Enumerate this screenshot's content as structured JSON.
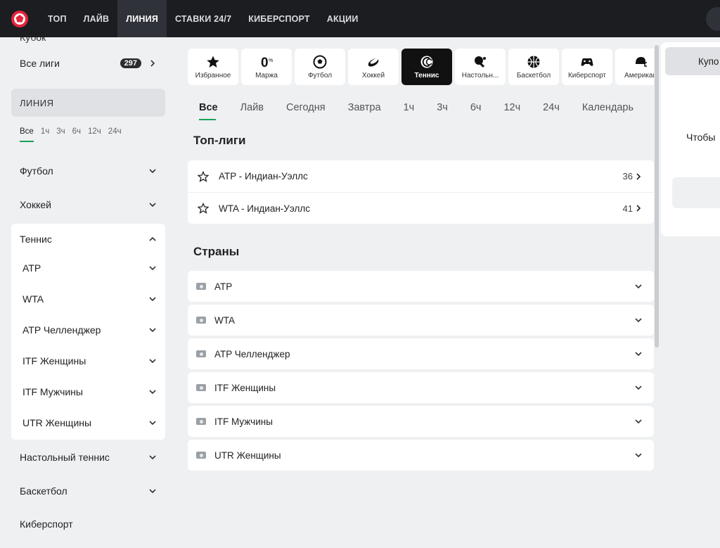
{
  "nav": {
    "items": [
      "ТОП",
      "ЛАЙВ",
      "ЛИНИЯ",
      "СТАВКИ 24/7",
      "КИБЕРСПОРТ",
      "АКЦИИ"
    ],
    "active_index": 2
  },
  "sidebar": {
    "cut_label": "Кубок",
    "all_leagues": "Все лиги",
    "all_leagues_count": "297",
    "section_title": "ЛИНИЯ",
    "time_filters": [
      "Все",
      "1ч",
      "3ч",
      "6ч",
      "12ч",
      "24ч"
    ],
    "sports_top": [
      "Футбол",
      "Хоккей"
    ],
    "expanded_sport": "Теннис",
    "tennis_sub": [
      "ATP",
      "WTA",
      "ATP Челленджер",
      "ITF Женщины",
      "ITF Мужчины",
      "UTR Женщины"
    ],
    "sports_bottom": [
      "Настольный теннис",
      "Баскетбол",
      "Киберспорт"
    ]
  },
  "sports_bar": {
    "items": [
      {
        "label": "Избранное",
        "icon": "star-icon"
      },
      {
        "label": "Маржа",
        "icon": "margin-zero-icon"
      },
      {
        "label": "Футбол",
        "icon": "soccer-ball-icon"
      },
      {
        "label": "Хоккей",
        "icon": "hockey-puck-icon"
      },
      {
        "label": "Теннис",
        "icon": "tennis-ball-icon"
      },
      {
        "label": "Настольн...",
        "icon": "table-tennis-icon"
      },
      {
        "label": "Баскетбол",
        "icon": "basketball-icon"
      },
      {
        "label": "Киберспорт",
        "icon": "gamepad-icon"
      },
      {
        "label": "Американ",
        "icon": "american-football-helmet-icon"
      }
    ],
    "active_index": 4
  },
  "tabs": {
    "items": [
      "Все",
      "Лайв",
      "Сегодня",
      "Завтра",
      "1ч",
      "3ч",
      "6ч",
      "12ч",
      "24ч",
      "Календарь"
    ],
    "active_index": 0
  },
  "top_leagues": {
    "title": "Топ-лиги",
    "items": [
      {
        "name": "ATP - Индиан-Уэллс",
        "count": "36"
      },
      {
        "name": "WTA - Индиан-Уэллс",
        "count": "41"
      }
    ]
  },
  "countries": {
    "title": "Страны",
    "items": [
      "ATP",
      "WTA",
      "ATP Челленджер",
      "ITF Женщины",
      "ITF Мужчины",
      "UTR Женщины"
    ]
  },
  "right_panel": {
    "coupon_tab": "Купо",
    "message": "Чтобы"
  },
  "colors": {
    "accent": "#19a355",
    "nav_bg": "#1b1d21",
    "logo_red": "#e3243b"
  }
}
